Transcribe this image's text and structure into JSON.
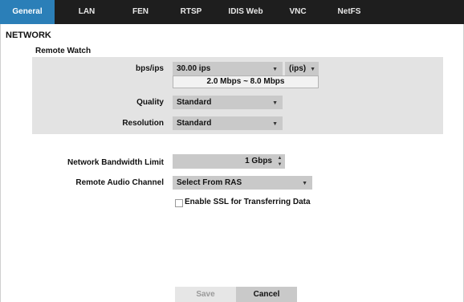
{
  "tabs": [
    {
      "label": "General",
      "active": true
    },
    {
      "label": "LAN",
      "active": false
    },
    {
      "label": "FEN",
      "active": false
    },
    {
      "label": "RTSP",
      "active": false
    },
    {
      "label": "IDIS Web",
      "active": false
    },
    {
      "label": "VNC",
      "active": false
    },
    {
      "label": "NetFS",
      "active": false
    }
  ],
  "section_title": "NETWORK",
  "remote_watch": {
    "title": "Remote Watch",
    "bps_label": "bps/ips",
    "bps_value": "30.00 ips",
    "unit_value": "(ips)",
    "range_text": "2.0 Mbps ~ 8.0 Mbps",
    "quality_label": "Quality",
    "quality_value": "Standard",
    "resolution_label": "Resolution",
    "resolution_value": "Standard"
  },
  "bandwidth": {
    "label": "Network Bandwidth Limit",
    "value": "1 Gbps"
  },
  "audio": {
    "label": "Remote Audio Channel",
    "value": "Select From RAS"
  },
  "ssl": {
    "label": "Enable SSL for Transferring Data",
    "checked": false
  },
  "buttons": {
    "save": "Save",
    "cancel": "Cancel"
  },
  "colors": {
    "tabbar_bg": "#1e1e1e",
    "active_tab": "#2b7fb8",
    "panel_bg": "#e3e3e3",
    "control_bg": "#c9c9c9"
  },
  "icons": {
    "dropdown": "chevron-down-icon",
    "step_up": "triangle-up-icon",
    "step_down": "triangle-down-icon"
  }
}
